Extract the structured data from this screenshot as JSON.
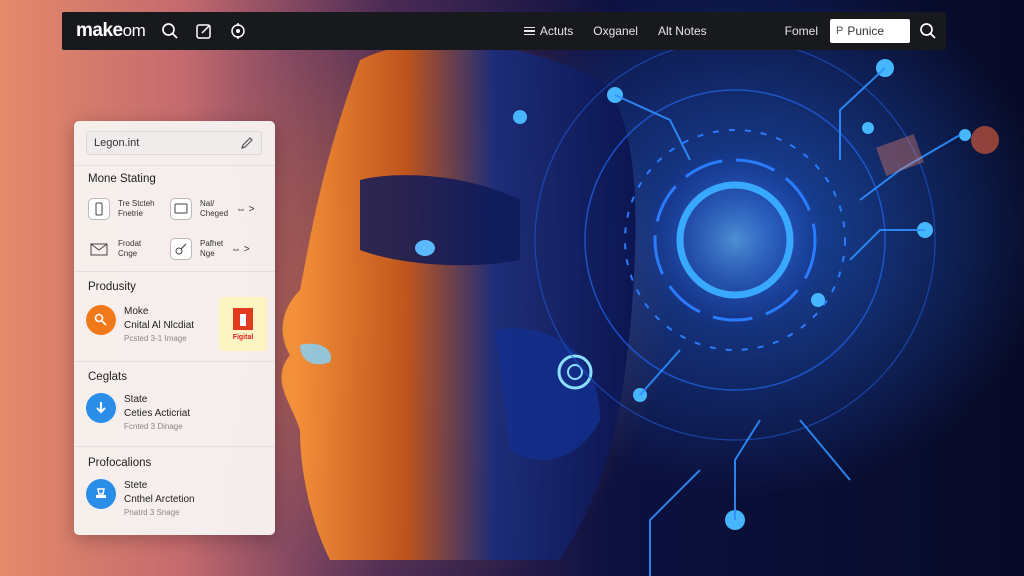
{
  "topbar": {
    "brand_main": "make",
    "brand_suffix": "om",
    "nav": [
      "Actuts",
      "Oxganel",
      "Alt Notes"
    ],
    "right_label": "Fomel",
    "search_prefix": "P",
    "search_value": "Punice"
  },
  "panel": {
    "search_value": "Legon.int",
    "section1_title": "Mone Stating",
    "tiles": [
      {
        "line1": "Tre Stcteh",
        "line2": "Fnetrie",
        "icon": "phone-icon"
      },
      {
        "line1": "Nal/",
        "line2": "Cheged",
        "icon": "tablet-icon",
        "arrows": "⇔ >"
      },
      {
        "line1": "Frodat",
        "line2": "Cnge",
        "icon": "mail-icon"
      },
      {
        "line1": "Pafhet",
        "line2": "Nge",
        "icon": "tools-icon",
        "arrows": "⇔ >"
      }
    ],
    "section2_title": "Produsity",
    "row1": {
      "title": "Moke",
      "subtitle": "Cnital Al Nlcdiat",
      "meta": "Pcsted 3-1 Image",
      "color": "#f07a1a"
    },
    "figma_label": "Figital",
    "section3_title": "Ceglats",
    "row2": {
      "title": "State",
      "subtitle": "Ceties Acticriat",
      "meta": "Fcnted 3 Dinage",
      "color": "#2a8ee8"
    },
    "section4_title": "Profocalions",
    "row3": {
      "title": "Stete",
      "subtitle": "Cnthel Arctetion",
      "meta": "Pnatrd 3 Snage",
      "color": "#2a8ee8"
    }
  }
}
